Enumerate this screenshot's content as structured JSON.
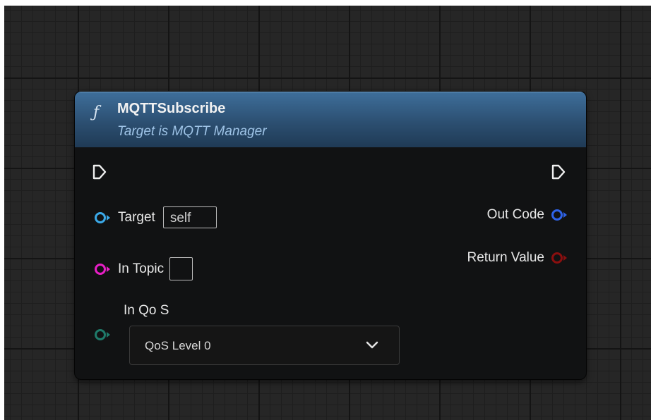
{
  "node": {
    "icon": "function-icon",
    "icon_glyph": "ƒ",
    "title": "MQTTSubscribe",
    "subtitle": "Target is MQTT Manager",
    "header_color": "#2c4f71"
  },
  "inputs": {
    "target": {
      "label": "Target",
      "default_value": "self",
      "pin_color": "#3ba9e8"
    },
    "in_topic": {
      "label": "In Topic",
      "default_value": "",
      "pin_color": "#e81fc6"
    },
    "in_qos": {
      "label": "In Qo S",
      "selected": "QoS Level 0",
      "pin_color": "#1f7a6a"
    }
  },
  "outputs": {
    "out_code": {
      "label": "Out Code",
      "pin_color": "#2f63e8"
    },
    "return_value": {
      "label": "Return Value",
      "pin_color": "#8a0f0f"
    }
  }
}
